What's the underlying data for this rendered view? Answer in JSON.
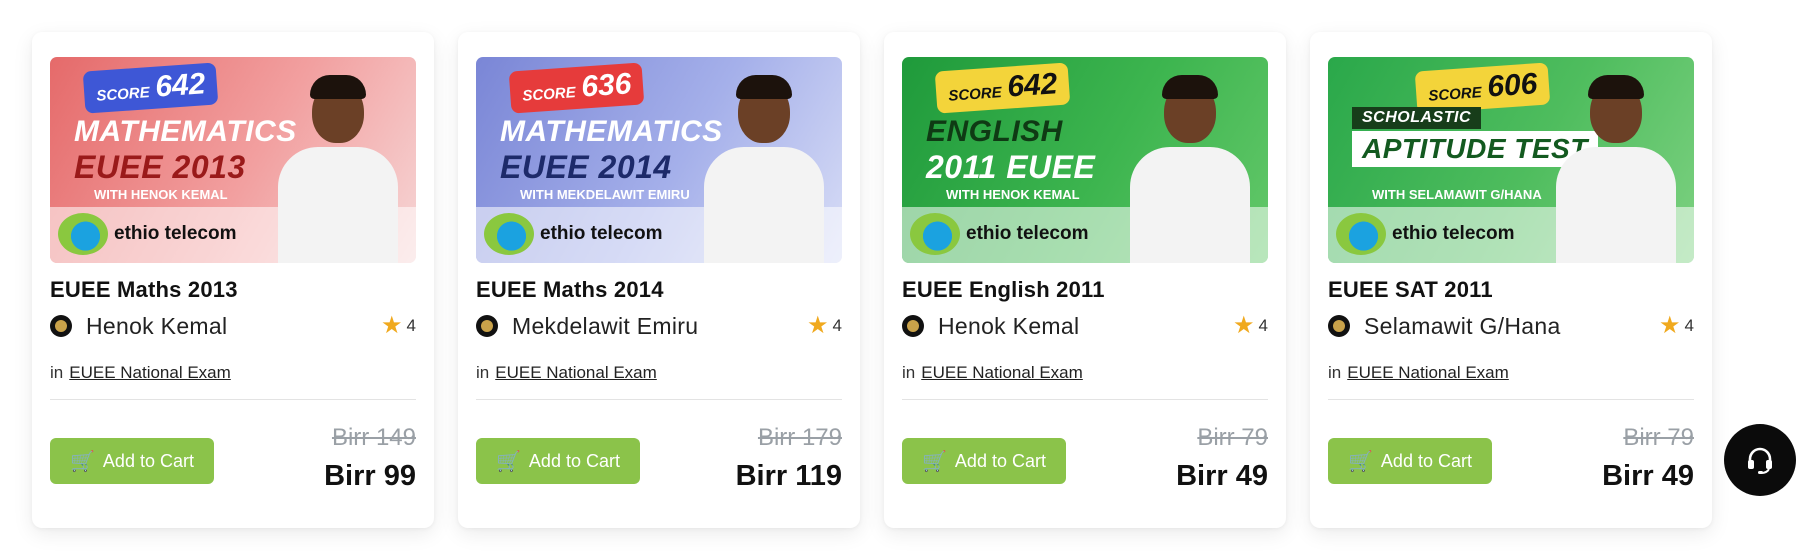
{
  "courses": [
    {
      "thumb": {
        "score_label": "SCORE",
        "score": "642",
        "line1": "MATHEMATICS",
        "line2": "EUEE 2013",
        "with": "WITH HENOK KEMAL",
        "logo_text": "ethio telecom"
      },
      "title": "EUEE Maths 2013",
      "author": "Henok Kemal",
      "rating": "4",
      "category_prefix": "in",
      "category": "EUEE National Exam",
      "cart_label": "Add to Cart",
      "old_price": "Birr 149",
      "new_price": "Birr 99"
    },
    {
      "thumb": {
        "score_label": "SCORE",
        "score": "636",
        "line1": "MATHEMATICS",
        "line2": "EUEE 2014",
        "with": "WITH MEKDELAWIT EMIRU",
        "logo_text": "ethio telecom"
      },
      "title": "EUEE Maths 2014",
      "author": "Mekdelawit Emiru",
      "rating": "4",
      "category_prefix": "in",
      "category": "EUEE National Exam",
      "cart_label": "Add to Cart",
      "old_price": "Birr 179",
      "new_price": "Birr 119"
    },
    {
      "thumb": {
        "score_label": "SCORE",
        "score": "642",
        "line1": "ENGLISH",
        "line2": "2011 EUEE",
        "with": "WITH HENOK KEMAL",
        "logo_text": "ethio telecom"
      },
      "title": "EUEE English 2011",
      "author": "Henok Kemal",
      "rating": "4",
      "category_prefix": "in",
      "category": "EUEE National Exam",
      "cart_label": "Add to Cart",
      "old_price": "Birr 79",
      "new_price": "Birr 49"
    },
    {
      "thumb": {
        "score_label": "SCORE",
        "score": "606",
        "line1": "SCHOLASTIC",
        "line2": "APTITUDE TEST",
        "with": "WITH SELAMAWIT G/HANA",
        "logo_text": "ethio telecom"
      },
      "title": "EUEE SAT 2011",
      "author": "Selamawit G/Hana",
      "rating": "4",
      "category_prefix": "in",
      "category": "EUEE National Exam",
      "cart_label": "Add to Cart",
      "old_price": "Birr 79",
      "new_price": "Birr 49"
    }
  ],
  "icons": {
    "star": "star-icon",
    "cart": "cart-icon",
    "support": "headset-icon"
  },
  "colors": {
    "cart_button": "#8bc34a",
    "star": "#f0a91e",
    "support_button": "#0b0b0b"
  }
}
